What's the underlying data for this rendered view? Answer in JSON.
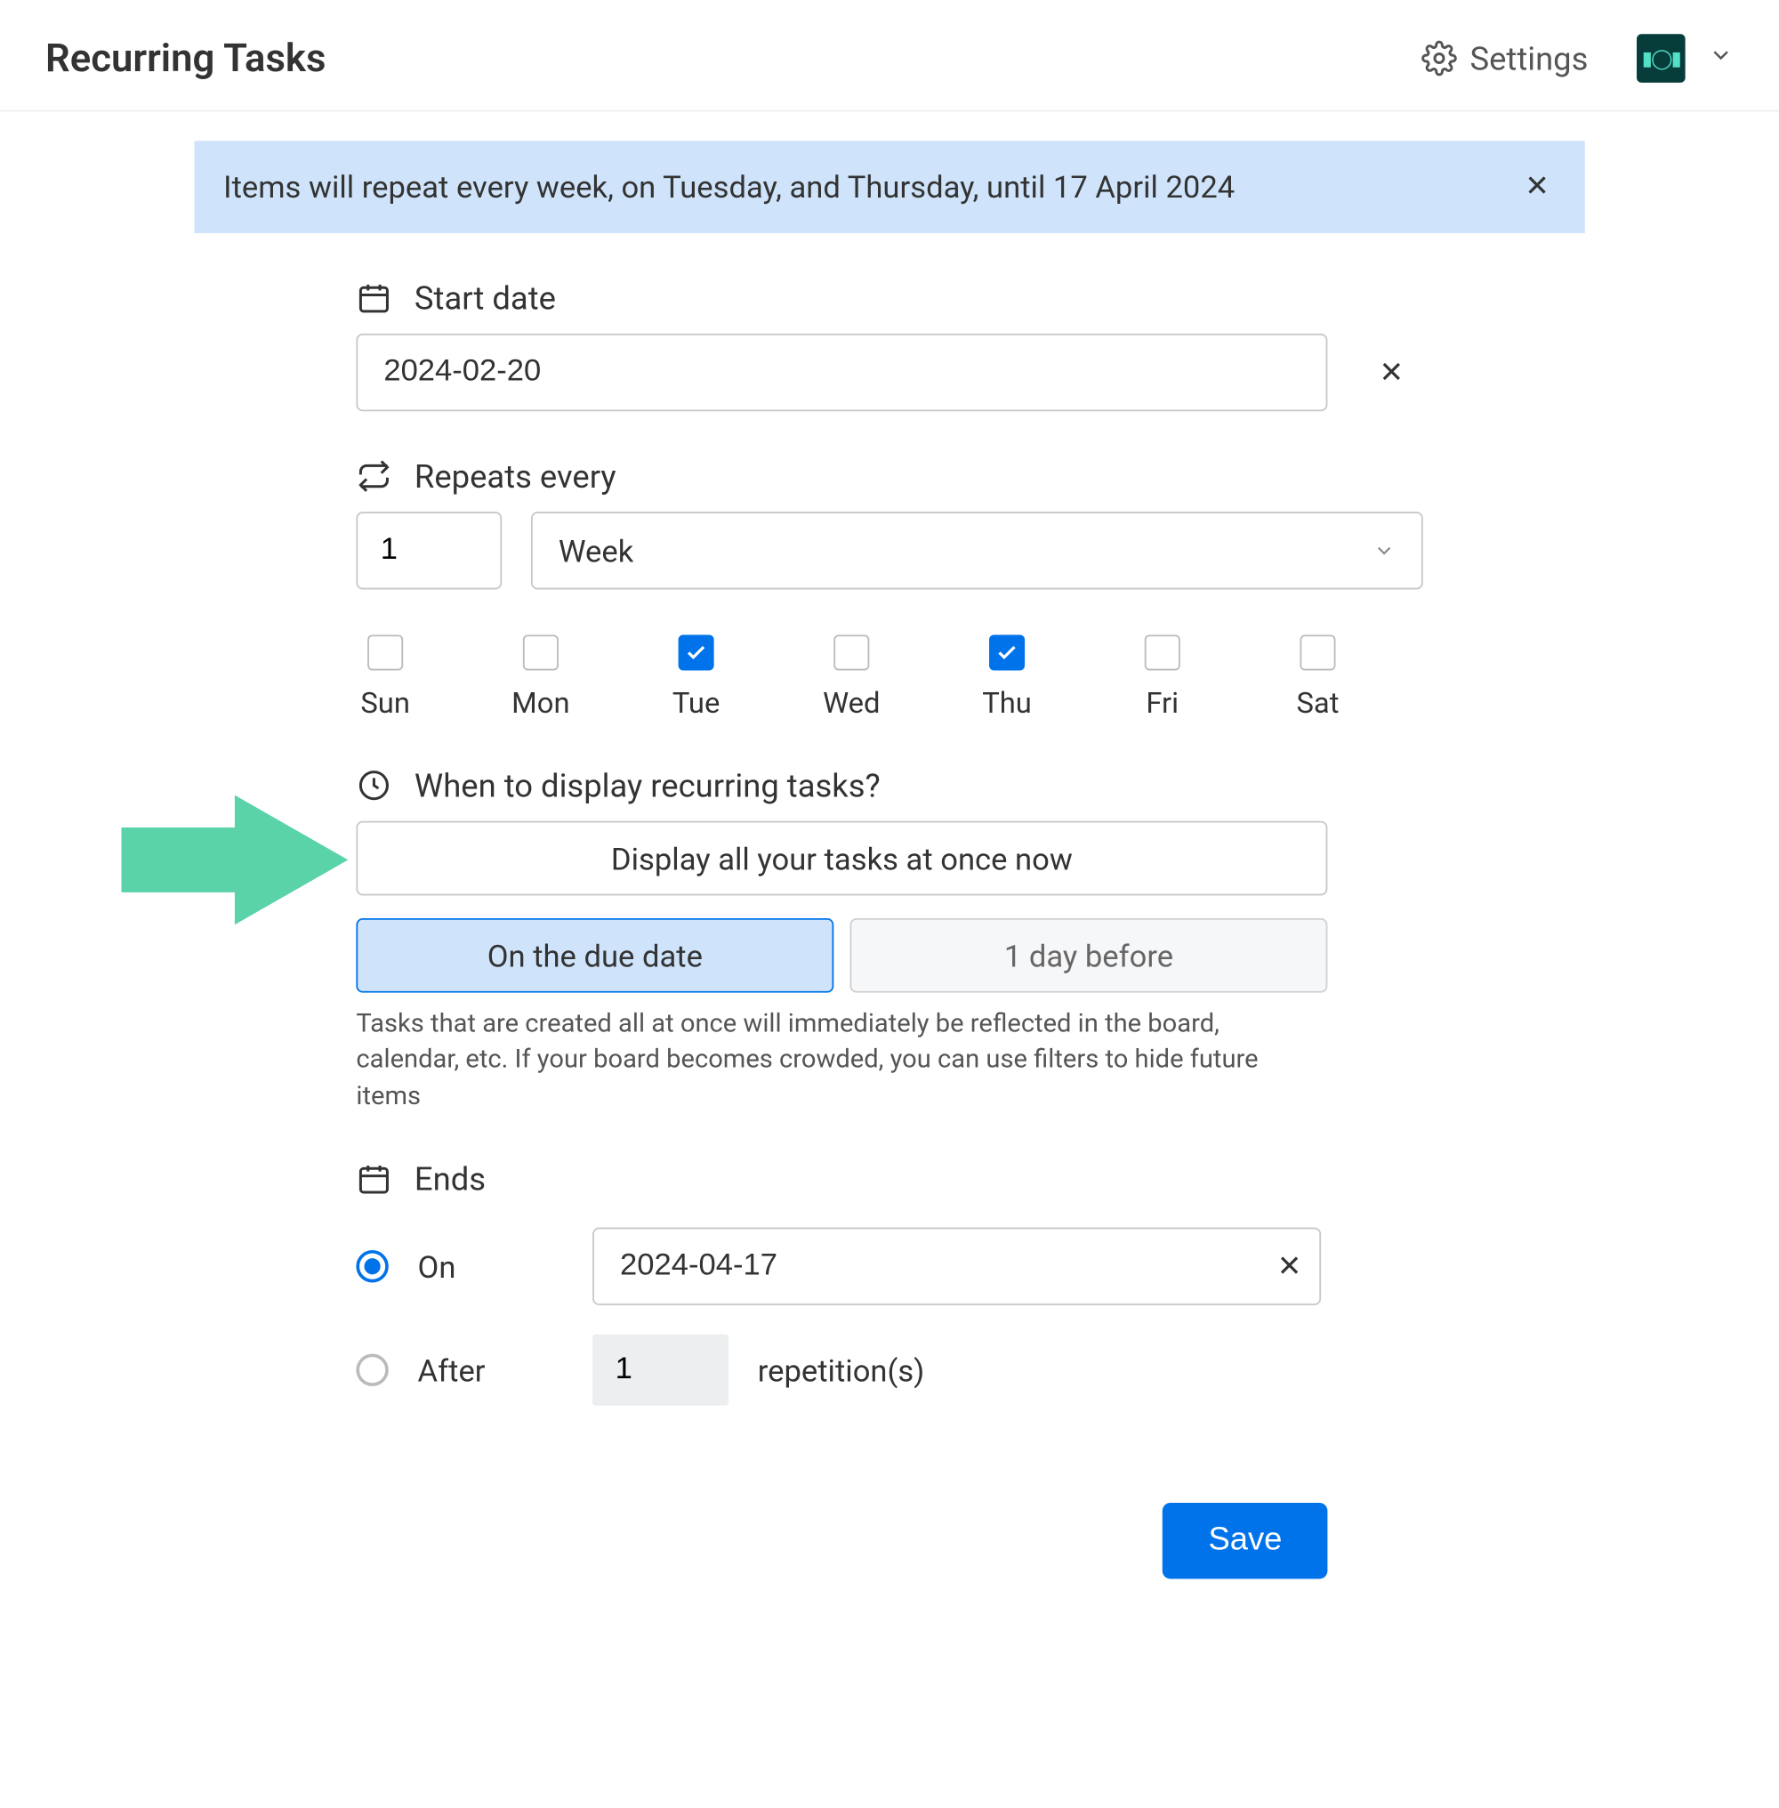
{
  "header": {
    "title": "Recurring Tasks",
    "settings_label": "Settings"
  },
  "banner": {
    "text": "Items will repeat every week, on Tuesday, and Thursday, until 17 April 2024"
  },
  "start_date": {
    "label": "Start date",
    "value": "2024-02-20"
  },
  "repeats": {
    "label": "Repeats every",
    "count": "1",
    "unit": "Week",
    "days": [
      {
        "abbr": "Sun",
        "checked": false
      },
      {
        "abbr": "Mon",
        "checked": false
      },
      {
        "abbr": "Tue",
        "checked": true
      },
      {
        "abbr": "Wed",
        "checked": false
      },
      {
        "abbr": "Thu",
        "checked": true
      },
      {
        "abbr": "Fri",
        "checked": false
      },
      {
        "abbr": "Sat",
        "checked": false
      }
    ]
  },
  "display": {
    "label": "When to display recurring tasks?",
    "all_at_once": "Display all your tasks at once now",
    "option_a": "On the due date",
    "option_b": "1 day before",
    "helper": "Tasks that are created all at once will immediately be reflected in the board, calendar, etc. If your board becomes crowded, you can use filters to hide future items"
  },
  "ends": {
    "label": "Ends",
    "on_label": "On",
    "on_value": "2024-04-17",
    "after_label": "After",
    "after_value": "1",
    "repetitions_label": "repetition(s)"
  },
  "save_label": "Save"
}
